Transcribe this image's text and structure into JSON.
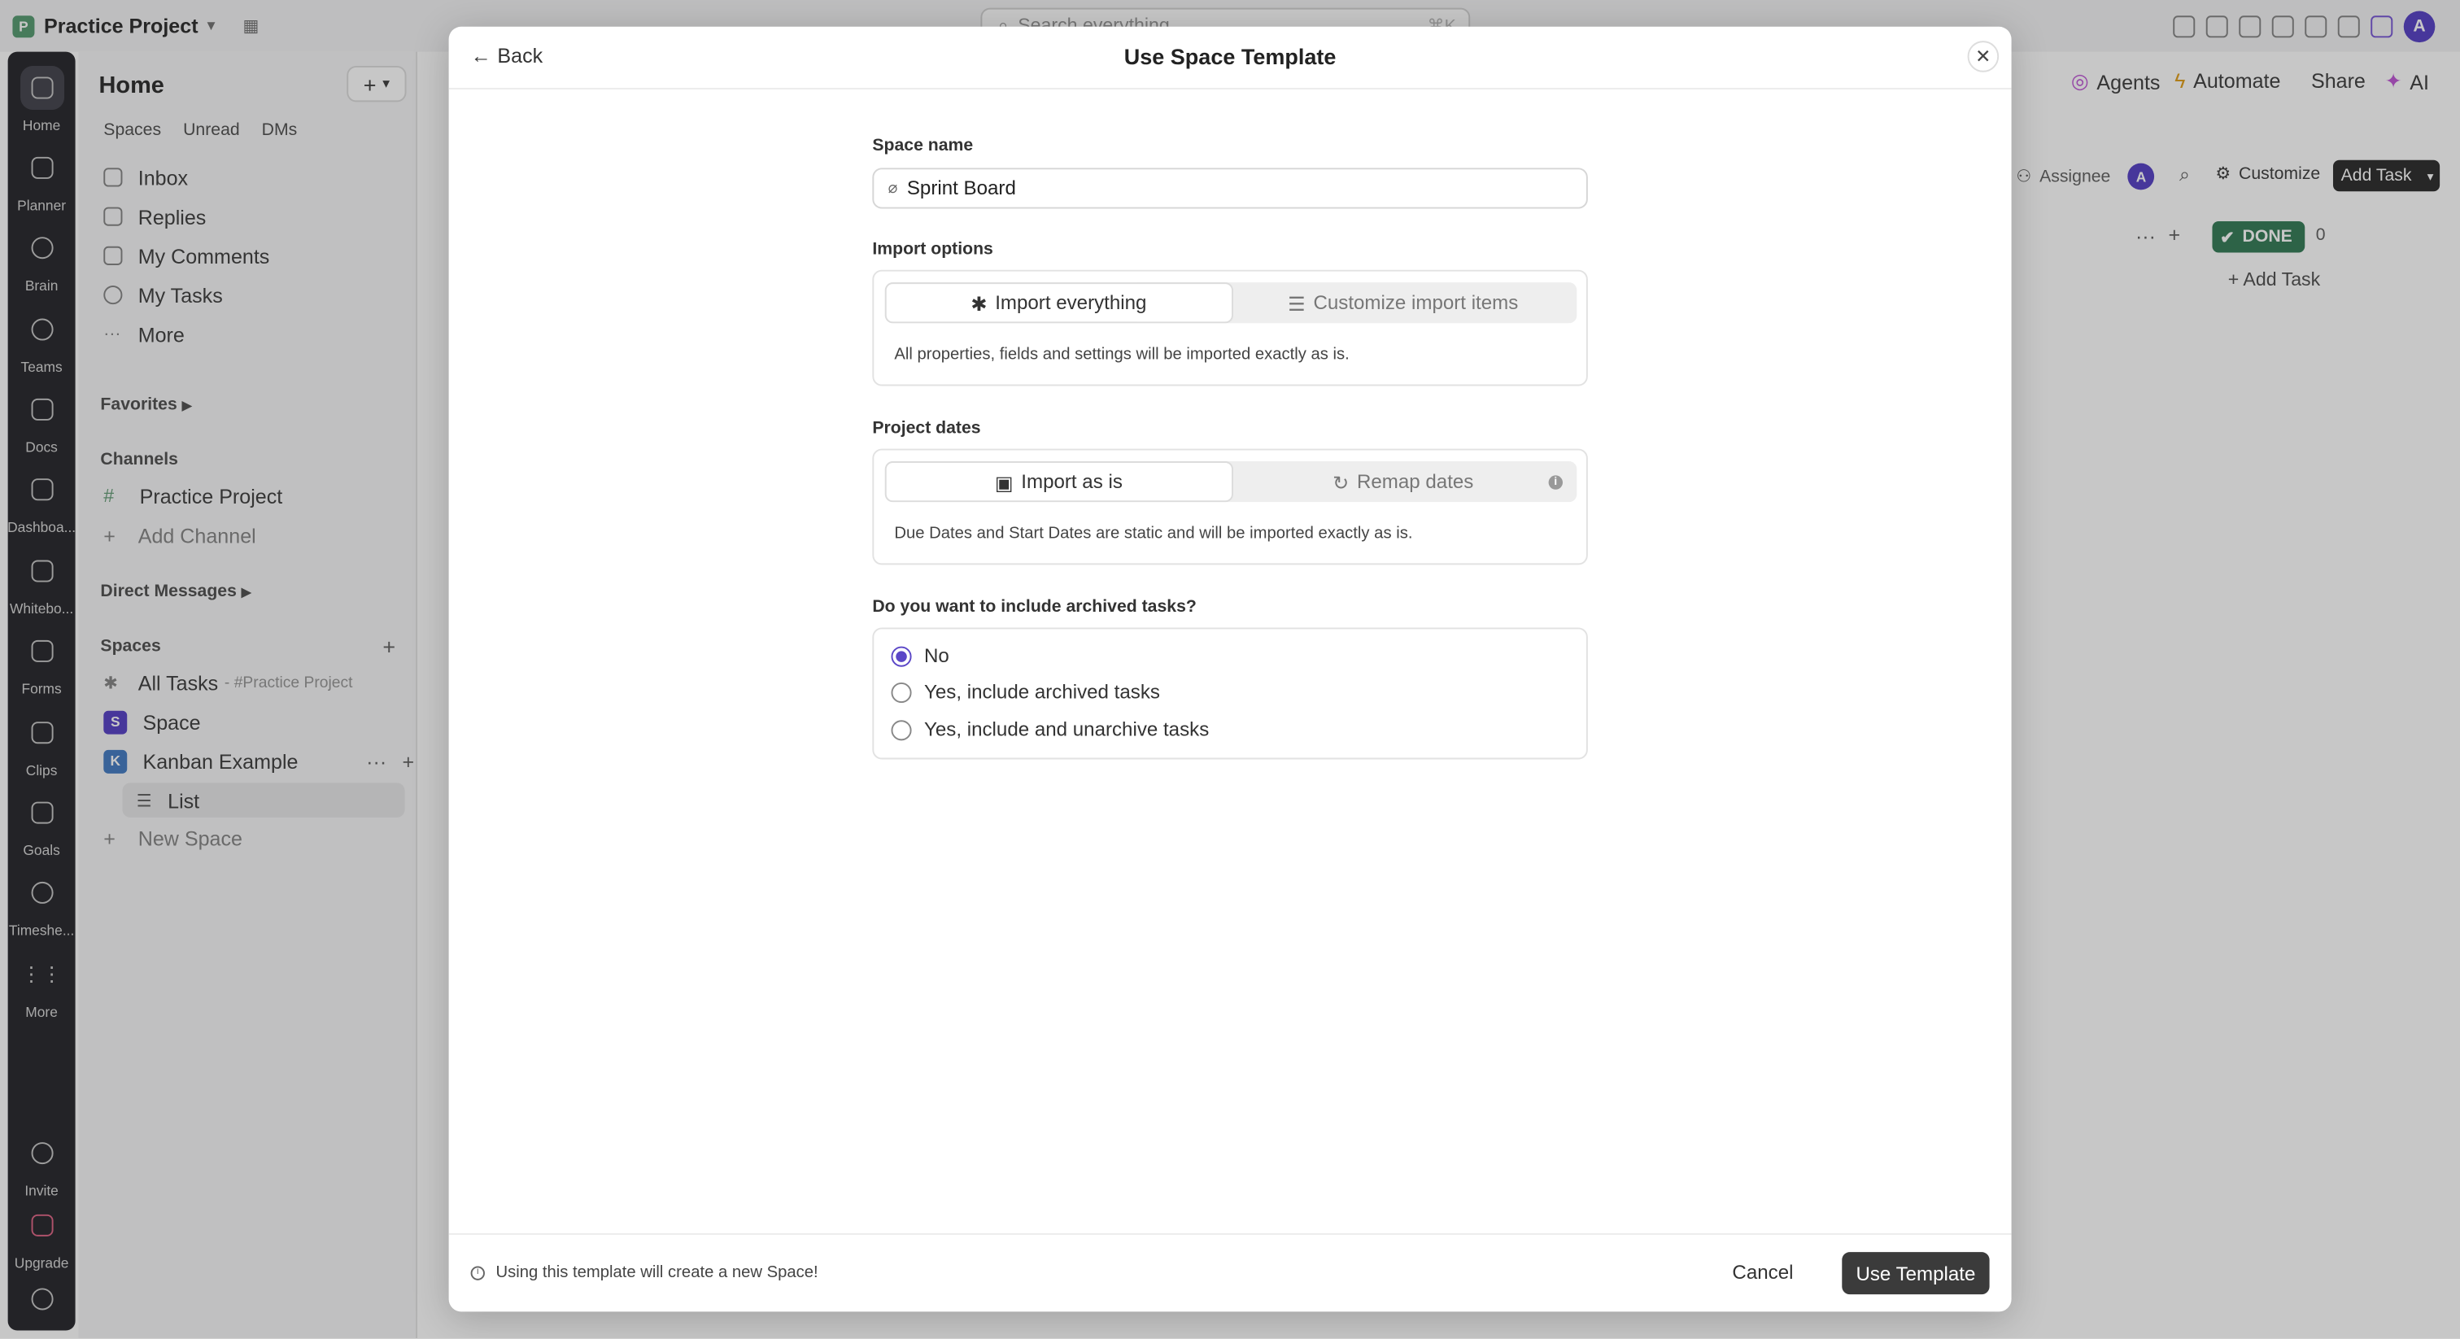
{
  "topbar": {
    "workspace_initial": "P",
    "workspace_name": "Practice Project",
    "search_placeholder": "Search everything...",
    "search_shortcut": "⌘K",
    "user_initial": "A"
  },
  "rail": {
    "items": [
      {
        "label": "Home"
      },
      {
        "label": "Planner"
      },
      {
        "label": "Brain"
      },
      {
        "label": "Teams"
      },
      {
        "label": "Docs"
      },
      {
        "label": "Dashboa..."
      },
      {
        "label": "Whitebo..."
      },
      {
        "label": "Forms"
      },
      {
        "label": "Clips"
      },
      {
        "label": "Goals"
      },
      {
        "label": "Timeshe..."
      },
      {
        "label": "More"
      }
    ],
    "invite": "Invite",
    "upgrade": "Upgrade"
  },
  "sidebar": {
    "title": "Home",
    "tabs": [
      "Spaces",
      "Unread",
      "DMs"
    ],
    "nav": [
      "Inbox",
      "Replies",
      "My Comments",
      "My Tasks",
      "More"
    ],
    "favorites": "Favorites",
    "channels_heading": "Channels",
    "channel": "Practice Project",
    "add_channel": "Add Channel",
    "direct_messages": "Direct Messages",
    "spaces_heading": "Spaces",
    "all_tasks": "All Tasks",
    "all_tasks_suffix": "- #Practice Project",
    "space_initial": "S",
    "space_name": "Space",
    "kanban_initial": "K",
    "kanban_name": "Kanban Example",
    "list_name": "List",
    "new_space": "New Space"
  },
  "main": {
    "agents": "Agents",
    "automate": "Automate",
    "share": "Share",
    "ai": "AI",
    "assignee": "Assignee",
    "assignee_initial": "A",
    "customize": "Customize",
    "add_task": "Add Task",
    "done_label": "DONE",
    "done_count": "0",
    "add_task_column": "+ Add Task"
  },
  "modal": {
    "back": "Back",
    "title": "Use Space Template",
    "space_name_label": "Space name",
    "space_name_value": "Sprint Board",
    "import_options_label": "Import options",
    "import_everything": "Import everything",
    "customize_import": "Customize import items",
    "import_desc": "All properties, fields and settings will be imported exactly as is.",
    "project_dates_label": "Project dates",
    "import_as_is": "Import as is",
    "remap_dates": "Remap dates",
    "dates_desc": "Due Dates and Start Dates are static and will be imported exactly as is.",
    "archived_question": "Do you want to include archived tasks?",
    "archived_options": [
      "No",
      "Yes, include archived tasks",
      "Yes, include and unarchive tasks"
    ],
    "footer_note": "Using this template will create a new Space!",
    "cancel": "Cancel",
    "use_template": "Use Template"
  }
}
